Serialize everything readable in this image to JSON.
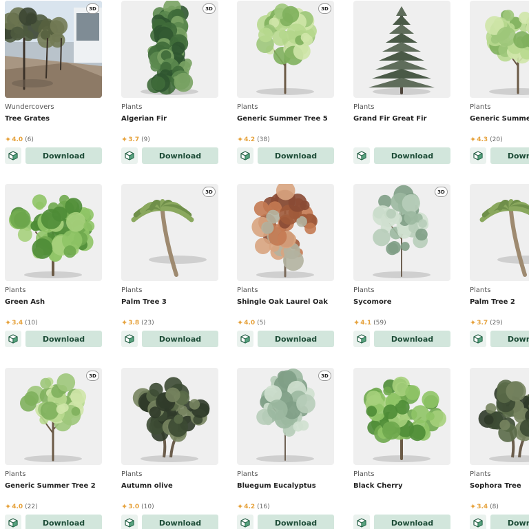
{
  "badge_label": "3D",
  "download_label": "Download",
  "colors": {
    "download_bg": "#d2e6dc",
    "download_text": "#1e4d38",
    "star": "#e6a23c",
    "thumb_bg": "#efefef"
  },
  "icons": {
    "rating": "star-icon",
    "model": "cube-icon",
    "badge": "3d-badge-icon"
  },
  "products": [
    {
      "category": "Wundercovers",
      "title": "Tree Grates",
      "rating": "4.0",
      "reviews": "(6)",
      "has_3d": true,
      "has_rating": true,
      "kind": "photo"
    },
    {
      "category": "Plants",
      "title": "Algerian Fir",
      "rating": "3.7",
      "reviews": "(9)",
      "has_3d": true,
      "has_rating": true,
      "kind": "fir"
    },
    {
      "category": "Plants",
      "title": "Generic Summer Tree 5",
      "rating": "4.2",
      "reviews": "(38)",
      "has_3d": true,
      "has_rating": true,
      "kind": "light"
    },
    {
      "category": "Plants",
      "title": "Grand Fir Great Fir",
      "rating": "",
      "reviews": "",
      "has_3d": false,
      "has_rating": false,
      "kind": "conifer"
    },
    {
      "category": "Plants",
      "title": "Generic Summer Tree",
      "rating": "4.3",
      "reviews": "(20)",
      "has_3d": false,
      "has_rating": true,
      "kind": "light"
    },
    {
      "category": "Plants",
      "title": "Green Ash",
      "rating": "3.4",
      "reviews": "(10)",
      "has_3d": false,
      "has_rating": true,
      "kind": "broad"
    },
    {
      "category": "Plants",
      "title": "Palm Tree 3",
      "rating": "3.8",
      "reviews": "(23)",
      "has_3d": true,
      "has_rating": true,
      "kind": "palm"
    },
    {
      "category": "Plants",
      "title": "Shingle Oak Laurel Oak",
      "rating": "4.0",
      "reviews": "(5)",
      "has_3d": false,
      "has_rating": true,
      "kind": "autumn"
    },
    {
      "category": "Plants",
      "title": "Sycomore",
      "rating": "4.1",
      "reviews": "(59)",
      "has_3d": true,
      "has_rating": true,
      "kind": "sparse"
    },
    {
      "category": "Plants",
      "title": "Palm Tree 2",
      "rating": "3.7",
      "reviews": "(29)",
      "has_3d": false,
      "has_rating": true,
      "kind": "palm"
    },
    {
      "category": "Plants",
      "title": "Generic Summer Tree 2",
      "rating": "4.0",
      "reviews": "(22)",
      "has_3d": true,
      "has_rating": true,
      "kind": "light"
    },
    {
      "category": "Plants",
      "title": "Autumn olive",
      "rating": "3.0",
      "reviews": "(10)",
      "has_3d": false,
      "has_rating": true,
      "kind": "olive"
    },
    {
      "category": "Plants",
      "title": "Bluegum Eucalyptus",
      "rating": "4.2",
      "reviews": "(16)",
      "has_3d": true,
      "has_rating": true,
      "kind": "sparse"
    },
    {
      "category": "Plants",
      "title": "Black Cherry",
      "rating": "",
      "reviews": "",
      "has_3d": false,
      "has_rating": false,
      "kind": "broad"
    },
    {
      "category": "Plants",
      "title": "Sophora Tree",
      "rating": "3.4",
      "reviews": "(8)",
      "has_3d": false,
      "has_rating": true,
      "kind": "olive"
    }
  ]
}
